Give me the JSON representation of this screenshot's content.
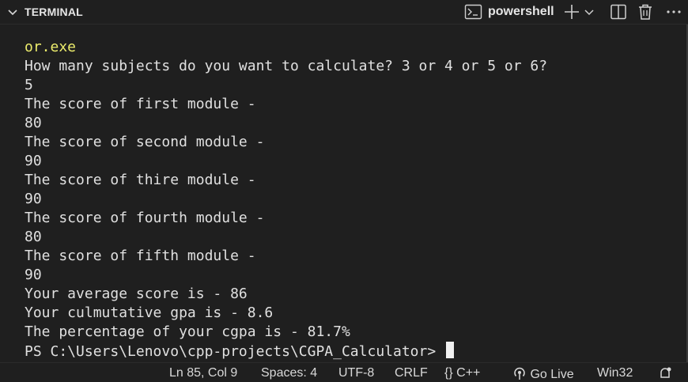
{
  "header": {
    "title": "TERMINAL",
    "shell": "powershell",
    "icons": [
      "chevron-down-icon",
      "terminal-icon",
      "plus-icon",
      "chevron-down-icon",
      "split-icon",
      "trash-icon",
      "more-icon"
    ]
  },
  "terminal": {
    "lines": [
      "or.exe",
      "How many subjects do you want to calculate? 3 or 4 or 5 or 6?",
      "5",
      "The score of first module -",
      "80",
      "The score of second module -",
      "90",
      "The score of thire module -",
      "90",
      "The score of fourth module -",
      "80",
      "The score of fifth module -",
      "90",
      "Your average score is - 86",
      "Your culmutative gpa is - 8.6",
      "The percentage of your cgpa is - 81.7%"
    ],
    "prompt": "PS C:\\Users\\Lenovo\\cpp-projects\\CGPA_Calculator> "
  },
  "statusbar": {
    "position": "Ln 85, Col 9",
    "spaces": "Spaces: 4",
    "encoding": "UTF-8",
    "eol": "CRLF",
    "language_brace": "{}",
    "language": "C++",
    "golive": "Go Live",
    "platform": "Win32"
  },
  "colors": {
    "background": "#1f1f1f",
    "text": "#e0e0e0",
    "highlight": "#ecec6c"
  }
}
